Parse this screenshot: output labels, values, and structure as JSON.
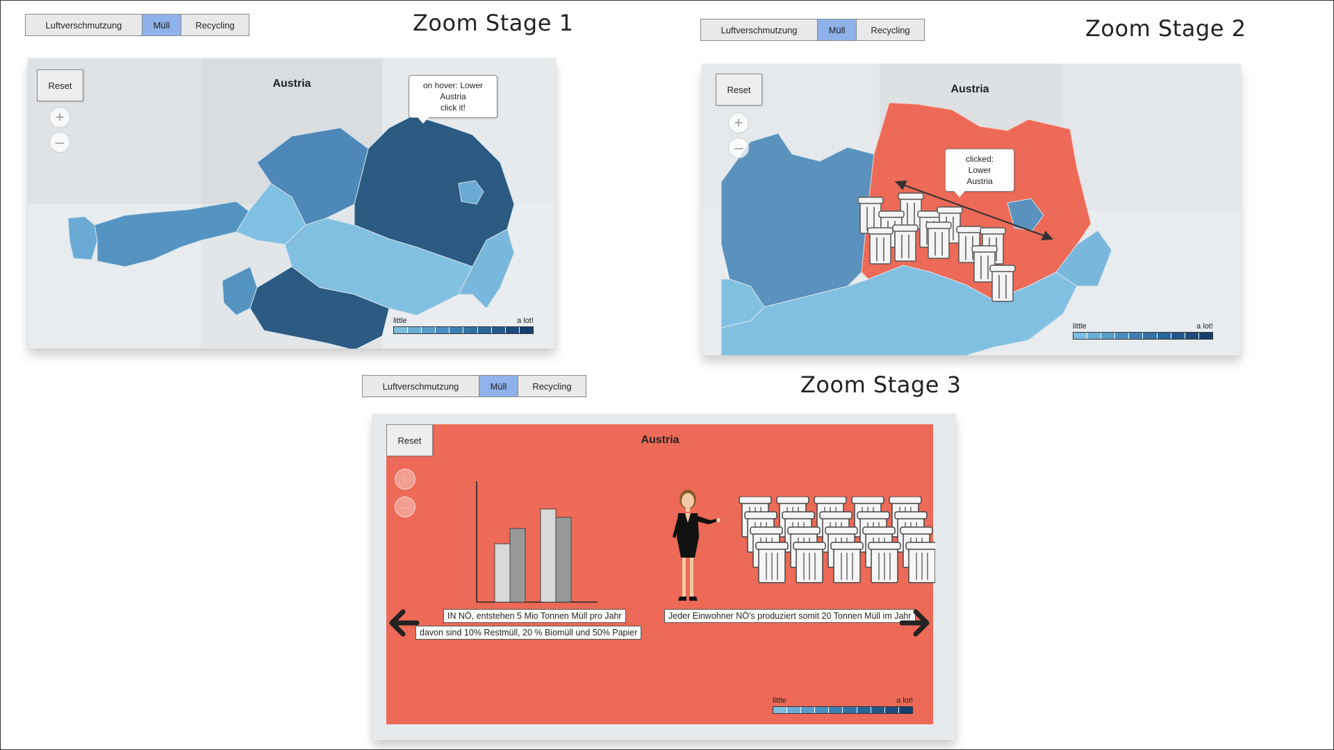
{
  "tabs": [
    "Luftverschmutzung",
    "Müll",
    "Recycling"
  ],
  "active_tab": "Müll",
  "stages": {
    "s1": {
      "title": "Zoom Stage 1",
      "map_title": "Austria",
      "reset": "Reset",
      "zoom_in": "+",
      "zoom_out": "–",
      "tooltip": [
        "on hover: Lower",
        "Austria",
        "click it!"
      ],
      "legend_low": "little",
      "legend_high": "a lot!"
    },
    "s2": {
      "title": "Zoom Stage 2",
      "map_title": "Austria",
      "reset": "Reset",
      "zoom_in": "+",
      "zoom_out": "–",
      "tooltip": [
        "clicked:",
        "Lower",
        "Austria"
      ],
      "legend_low": "little",
      "legend_high": "a lot!"
    },
    "s3": {
      "title": "Zoom Stage 3",
      "map_title": "Austria",
      "reset": "Reset",
      "zoom_in": "+",
      "zoom_out": "–",
      "caption1": "IN NÖ, entstehen 5 Mio Tonnen Müll pro Jahr",
      "caption2": "davon sind 10% Restmüll, 20 % Biomüll und 50% Papier",
      "caption3": "Jeder Einwohner NÖ's produziert somit 20 Tonnen Müll im Jahr",
      "prev": "🡐",
      "next": "🡒",
      "legend_low": "little",
      "legend_high": "a lot!"
    }
  },
  "colors": {
    "active_tab": "#8fb2ea",
    "highlight": "#ec6a57",
    "legend_scale": [
      "#7fbde0",
      "#6badd6",
      "#5a9dcb",
      "#4a8dbf",
      "#3e7fb2",
      "#3472a4",
      "#2a6597",
      "#22588a",
      "#1b4c7d",
      "#153f6f"
    ]
  }
}
